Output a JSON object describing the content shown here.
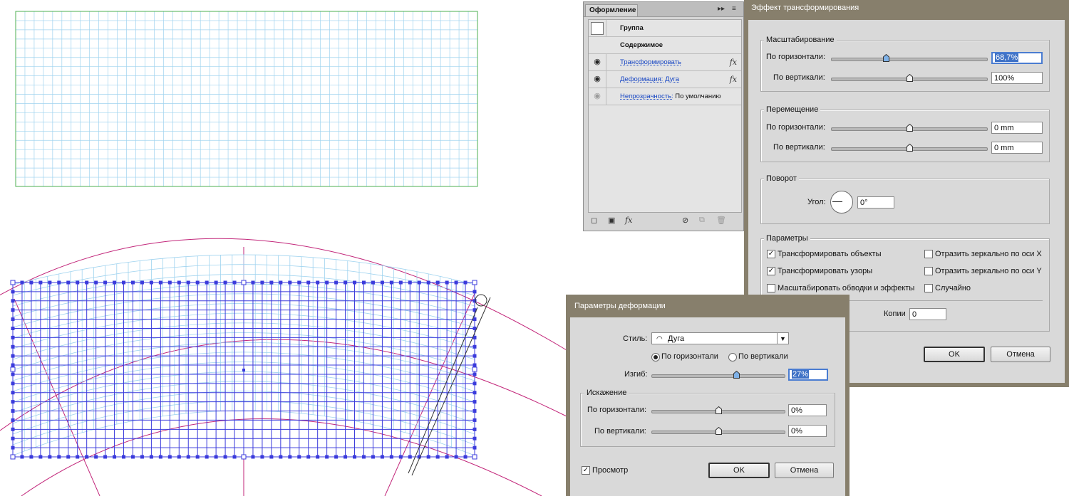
{
  "appearance_panel": {
    "tab_label": "Оформление",
    "collapse_glyph": "▸▸",
    "menu_glyph": "≡",
    "rows": {
      "group": "Группа",
      "contents": "Содержимое",
      "transform": "Трансформировать",
      "warp": "Деформация: Дуга",
      "opacity_label": "Непрозрачность:",
      "opacity_value": "По умолчанию"
    },
    "fx_glyph": "fx",
    "eye_glyph": "◉"
  },
  "transform_dialog": {
    "title": "Эффект трансформирования",
    "scale": {
      "group_label": "Масштабирование",
      "horizontal_label": "По горизонтали:",
      "horizontal_value": "68,7%",
      "vertical_label": "По вертикали:",
      "vertical_value": "100%"
    },
    "move": {
      "group_label": "Перемещение",
      "horizontal_label": "По горизонтали:",
      "horizontal_value": "0 mm",
      "vertical_label": "По вертикали:",
      "vertical_value": "0 mm"
    },
    "rotate": {
      "group_label": "Поворот",
      "angle_label": "Угол:",
      "angle_value": "0°"
    },
    "options": {
      "group_label": "Параметры",
      "transform_objects": "Трансформировать объекты",
      "transform_patterns": "Трансформировать узоры",
      "scale_strokes": "Масштабировать обводки и эффекты",
      "reflect_x": "Отразить зеркально по оси X",
      "reflect_y": "Отразить зеркально по оси Y",
      "random": "Случайно"
    },
    "copies_label": "Копии",
    "copies_value": "0",
    "ok_label": "OK",
    "cancel_label": "Отмена"
  },
  "warp_dialog": {
    "title": "Параметры деформации",
    "style_label": "Стиль:",
    "style_value": "Дуга",
    "orient_horizontal": "По горизонтали",
    "orient_vertical": "По вертикали",
    "bend_label": "Изгиб:",
    "bend_value": "27%",
    "distortion": {
      "group_label": "Искажение",
      "horizontal_label": "По горизонтали:",
      "horizontal_value": "0%",
      "vertical_label": "По вертикали:",
      "vertical_value": "0%"
    },
    "preview_label": "Просмотр",
    "ok_label": "OK",
    "cancel_label": "Отмена"
  },
  "slider_levels": {
    "scale_horizontal": 0.35,
    "scale_vertical": 0.5,
    "move_horizontal": 0.5,
    "move_vertical": 0.5,
    "bend": 0.635,
    "distort_horizontal": 0.5,
    "distort_vertical": 0.5
  },
  "colors": {
    "dialog_title_bg": "#877f6c",
    "grid_line": "#9fd3ef",
    "grid_border": "#4caf50",
    "selection": "#3b3bdc",
    "guide": "#c2267a",
    "accent_select": "#3f72c6"
  }
}
